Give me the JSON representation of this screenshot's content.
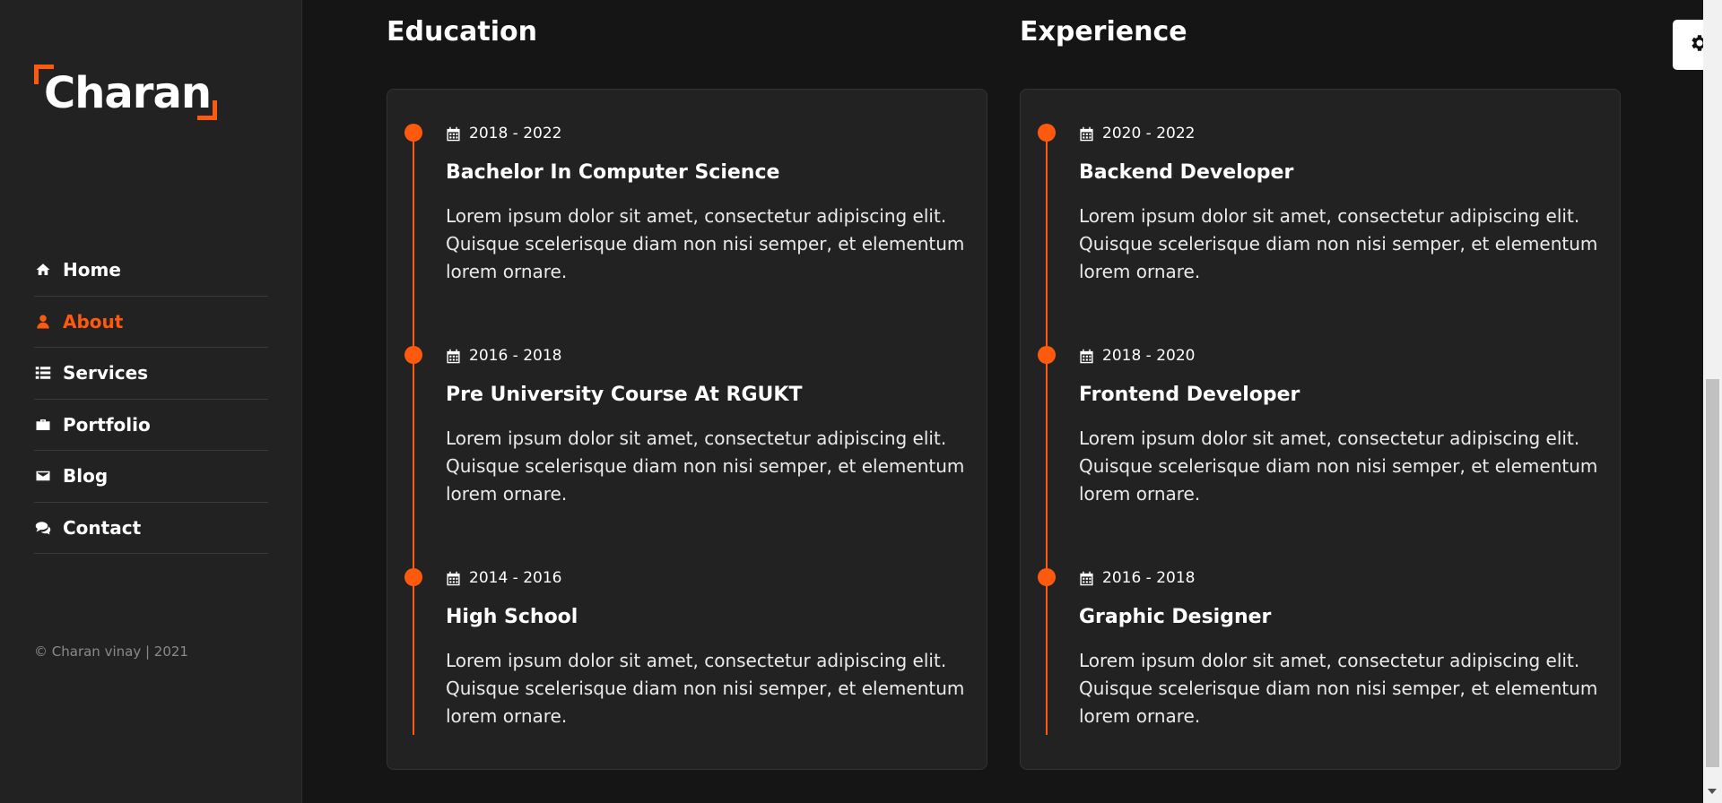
{
  "brand": {
    "logo_text": "Charan",
    "accent": "#fd5a0e"
  },
  "nav": {
    "items": [
      {
        "label": "Home",
        "icon": "home-icon",
        "active": false
      },
      {
        "label": "About",
        "icon": "user-icon",
        "active": true
      },
      {
        "label": "Services",
        "icon": "list-icon",
        "active": false
      },
      {
        "label": "Portfolio",
        "icon": "briefcase-icon",
        "active": false
      },
      {
        "label": "Blog",
        "icon": "envelope-icon",
        "active": false
      },
      {
        "label": "Contact",
        "icon": "comments-icon",
        "active": false
      }
    ]
  },
  "footer": {
    "copyright": "© Charan vinay | 2021"
  },
  "education": {
    "heading": "Education",
    "entries": [
      {
        "date": "2018 - 2022",
        "title": "Bachelor In Computer Science",
        "desc": "Lorem ipsum dolor sit amet, consectetur adipiscing elit. Quisque scelerisque diam non nisi semper, et elementum lorem ornare."
      },
      {
        "date": "2016 - 2018",
        "title": "Pre University Course At RGUKT",
        "desc": "Lorem ipsum dolor sit amet, consectetur adipiscing elit. Quisque scelerisque diam non nisi semper, et elementum lorem ornare."
      },
      {
        "date": "2014 - 2016",
        "title": "High School",
        "desc": "Lorem ipsum dolor sit amet, consectetur adipiscing elit. Quisque scelerisque diam non nisi semper, et elementum lorem ornare."
      }
    ]
  },
  "experience": {
    "heading": "Experience",
    "entries": [
      {
        "date": "2020 - 2022",
        "title": "Backend Developer",
        "desc": "Lorem ipsum dolor sit amet, consectetur adipiscing elit. Quisque scelerisque diam non nisi semper, et elementum lorem ornare."
      },
      {
        "date": "2018 - 2020",
        "title": "Frontend Developer",
        "desc": "Lorem ipsum dolor sit amet, consectetur adipiscing elit. Quisque scelerisque diam non nisi semper, et elementum lorem ornare."
      },
      {
        "date": "2016 - 2018",
        "title": "Graphic Designer",
        "desc": "Lorem ipsum dolor sit amet, consectetur adipiscing elit. Quisque scelerisque diam non nisi semper, et elementum lorem ornare."
      }
    ]
  },
  "settings": {
    "icon": "gear-icon"
  }
}
